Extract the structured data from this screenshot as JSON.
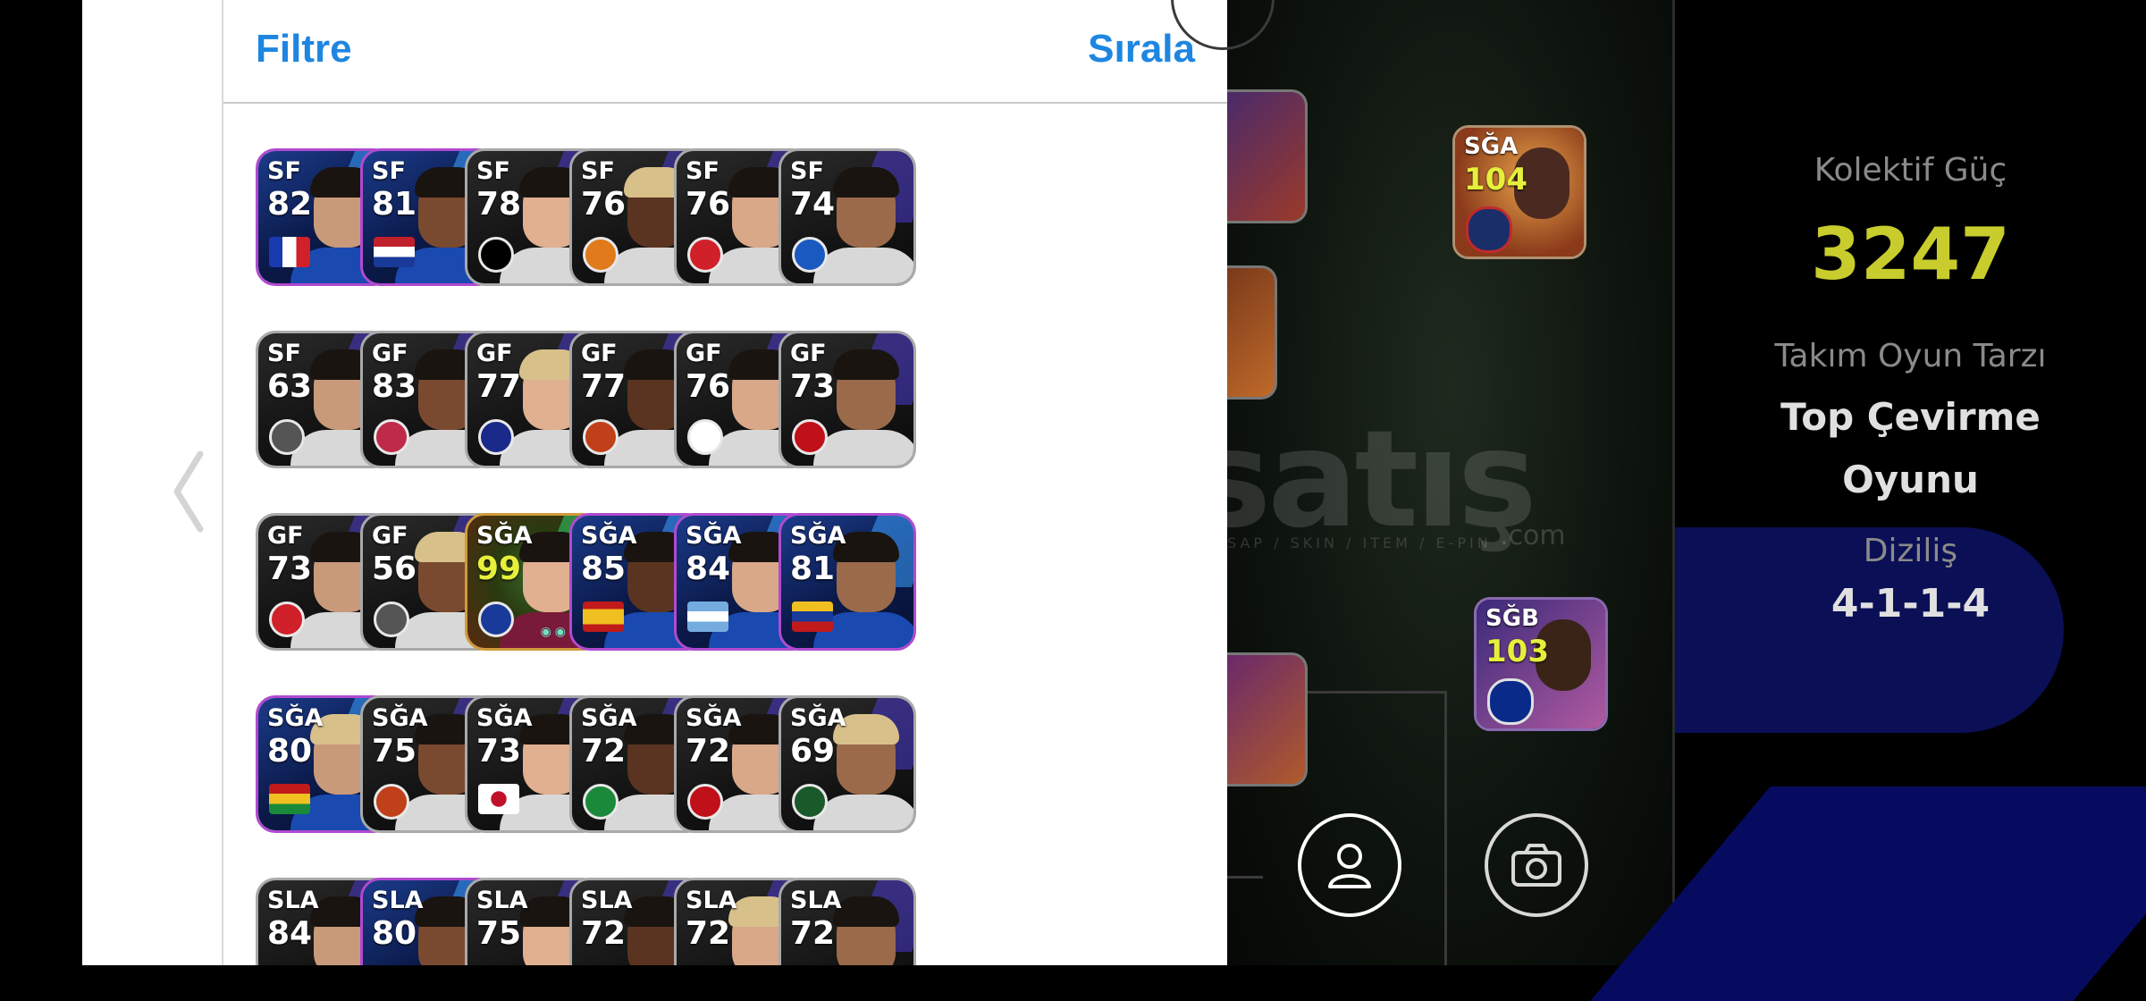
{
  "header": {
    "filter_label": "Filtre",
    "sort_label": "Sırala"
  },
  "players": [
    {
      "pos": "SF",
      "rating": "82",
      "theme": "blue",
      "flag": "france"
    },
    {
      "pos": "SF",
      "rating": "81",
      "theme": "blue",
      "flag": "netherlands"
    },
    {
      "pos": "SF",
      "rating": "78",
      "theme": "dark",
      "flag": "club-besiktas"
    },
    {
      "pos": "SF",
      "rating": "76",
      "theme": "dark",
      "flag": "club-orange"
    },
    {
      "pos": "SF",
      "rating": "76",
      "theme": "dark",
      "flag": "club-red"
    },
    {
      "pos": "SF",
      "rating": "74",
      "theme": "dark",
      "flag": "club-blue-shield"
    },
    {
      "pos": "SF",
      "rating": "63",
      "theme": "dark",
      "flag": "shield-grey"
    },
    {
      "pos": "GF",
      "rating": "83",
      "theme": "dark",
      "flag": "club-mds"
    },
    {
      "pos": "GF",
      "rating": "77",
      "theme": "dark",
      "flag": "club-fenerbahce"
    },
    {
      "pos": "GF",
      "rating": "77",
      "theme": "dark",
      "flag": "club-galatasaray"
    },
    {
      "pos": "GF",
      "rating": "76",
      "theme": "dark",
      "flag": "club-spfc"
    },
    {
      "pos": "GF",
      "rating": "73",
      "theme": "dark",
      "flag": "club-lille"
    },
    {
      "pos": "GF",
      "rating": "73",
      "theme": "dark",
      "flag": "club-olympiacos"
    },
    {
      "pos": "GF",
      "rating": "56",
      "theme": "dark",
      "flag": "shield-grey"
    },
    {
      "pos": "SĞA",
      "rating": "99",
      "theme": "gold",
      "flag": "club-barcelona"
    },
    {
      "pos": "SĞA",
      "rating": "85",
      "theme": "blue",
      "flag": "spain"
    },
    {
      "pos": "SĞA",
      "rating": "84",
      "theme": "blue",
      "flag": "argentina"
    },
    {
      "pos": "SĞA",
      "rating": "81",
      "theme": "blue",
      "flag": "venezuela"
    },
    {
      "pos": "SĞA",
      "rating": "80",
      "theme": "blue",
      "flag": "ghana"
    },
    {
      "pos": "SĞA",
      "rating": "75",
      "theme": "dark",
      "flag": "club-galatasaray"
    },
    {
      "pos": "SĞA",
      "rating": "73",
      "theme": "dark",
      "flag": "japan"
    },
    {
      "pos": "SĞA",
      "rating": "72",
      "theme": "dark",
      "flag": "club-rizespor"
    },
    {
      "pos": "SĞA",
      "rating": "72",
      "theme": "dark",
      "flag": "club-internacional"
    },
    {
      "pos": "SĞA",
      "rating": "69",
      "theme": "dark",
      "flag": "club-green"
    },
    {
      "pos": "SLA",
      "rating": "84",
      "theme": "dark",
      "flag": "none"
    },
    {
      "pos": "SLA",
      "rating": "80",
      "theme": "blue",
      "flag": "none"
    },
    {
      "pos": "SLA",
      "rating": "75",
      "theme": "dark",
      "flag": "none"
    },
    {
      "pos": "SLA",
      "rating": "72",
      "theme": "dark",
      "flag": "none"
    },
    {
      "pos": "SLA",
      "rating": "72",
      "theme": "dark",
      "flag": "none"
    },
    {
      "pos": "SLA",
      "rating": "72",
      "theme": "dark",
      "flag": "none"
    }
  ],
  "pitch_cards": [
    {
      "pos": "SĞA",
      "rating": "104",
      "club": "club-psg"
    },
    {
      "pos": "SĞB",
      "rating": "103",
      "club": "club-inter"
    }
  ],
  "sidebar": {
    "strength_label": "Kolektif Güç",
    "strength_value": "3247",
    "style_label": "Takım Oyun Tarzı",
    "style_value_line1": "Top Çevirme",
    "style_value_line2": "Oyunu",
    "formation_label": "Diziliş",
    "formation_value": "4-1-1-4"
  },
  "watermark": {
    "text": "satış",
    "suffix": ".com",
    "sub": "SAP / SKIN / ITEM / E-PIN"
  },
  "icons": {
    "back": "chevron-left-icon",
    "profile": "person-icon",
    "camera": "camera-icon"
  },
  "colors": {
    "accent": "#1e86e0",
    "strength": "#c8cc2c",
    "gold_rating": "#e6ef3b"
  }
}
